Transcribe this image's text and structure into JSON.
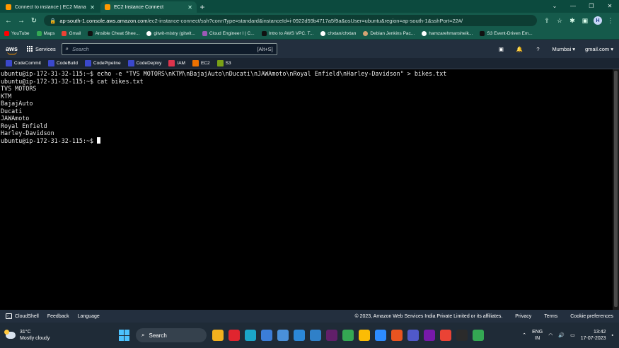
{
  "browser": {
    "tabs": [
      {
        "title": "Connect to instance | EC2 Manag",
        "active": false,
        "color": "#ff9900"
      },
      {
        "title": "EC2 Instance Connect",
        "active": true,
        "color": "#ff9900"
      }
    ],
    "url_host": "ap-south-1.console.aws.amazon.com",
    "url_path": "/ec2-instance-connect/ssh?connType=standard&instanceId=i-0922d59b4717a5f9a&osUser=ubuntu&region=ap-south-1&sshPort=22#/",
    "profile_initial": "H",
    "bookmarks": [
      {
        "label": "YouTube",
        "color": "#ff0000"
      },
      {
        "label": "Maps",
        "color": "#34a853"
      },
      {
        "label": "Gmail",
        "color": "#ea4335"
      },
      {
        "label": "Ansible Cheat Shee...",
        "color": "#111111"
      },
      {
        "label": "gitwit-mistry (gitwit...",
        "color": "#ffffff"
      },
      {
        "label": "Cloud Engineer I | C...",
        "color": "#9b59b6"
      },
      {
        "label": "Intro to AWS VPC. T...",
        "color": "#111111"
      },
      {
        "label": "chxtan/chxtan",
        "color": "#ffffff"
      },
      {
        "label": "Debian Jenkins Pac...",
        "color": "#d4a373"
      },
      {
        "label": "hamzarehmansheik...",
        "color": "#ffffff"
      },
      {
        "label": "S3 Event-Driven Em...",
        "color": "#111111"
      }
    ]
  },
  "aws": {
    "logo": "aws",
    "services_label": "Services",
    "search_placeholder": "Search",
    "search_shortcut": "[Alt+S]",
    "region": "Mumbai ▾",
    "account": "gmail.com ▾",
    "favorites": [
      {
        "label": "CodeCommit",
        "color": "#3b48cc"
      },
      {
        "label": "CodeBuild",
        "color": "#3b48cc"
      },
      {
        "label": "CodePipeline",
        "color": "#3b48cc"
      },
      {
        "label": "CodeDeploy",
        "color": "#3b48cc"
      },
      {
        "label": "IAM",
        "color": "#dd344c"
      },
      {
        "label": "EC2",
        "color": "#ed7100"
      },
      {
        "label": "S3",
        "color": "#7aa116"
      }
    ]
  },
  "terminal": {
    "lines": [
      "ubuntu@ip-172-31-32-115:~$ echo -e \"TVS MOTORS\\nKTM\\nBajajAuto\\nDucati\\nJAWAmoto\\nRoyal Enfield\\nHarley-Davidson\" > bikes.txt",
      "ubuntu@ip-172-31-32-115:~$ cat bikes.txt",
      "TVS MOTORS",
      "KTM",
      "BajajAuto",
      "Ducati",
      "JAWAmoto",
      "Royal Enfield",
      "Harley-Davidson"
    ],
    "prompt": "ubuntu@ip-172-31-32-115:~$ "
  },
  "footer": {
    "cloudshell": "CloudShell",
    "feedback": "Feedback",
    "language": "Language",
    "copyright": "© 2023, Amazon Web Services India Private Limited or its affiliates.",
    "privacy": "Privacy",
    "terms": "Terms",
    "cookie": "Cookie preferences"
  },
  "taskbar": {
    "temperature": "31°C",
    "weather": "Mostly cloudy",
    "search_label": "Search",
    "lang_top": "ENG",
    "lang_bottom": "IN",
    "time": "13:42",
    "date": "17-07-2023",
    "apps": [
      {
        "name": "file-explorer-icon",
        "color": "#f2b01e"
      },
      {
        "name": "opera-icon",
        "color": "#e0252f"
      },
      {
        "name": "edge-icon",
        "color": "#1ba6c9"
      },
      {
        "name": "store-icon",
        "color": "#3b7dd8"
      },
      {
        "name": "app-icon",
        "color": "#4a90d9"
      },
      {
        "name": "photos-icon",
        "color": "#2b88d8"
      },
      {
        "name": "vscode-icon",
        "color": "#2f80c8"
      },
      {
        "name": "slack-icon",
        "color": "#611f69"
      },
      {
        "name": "chrome-icon",
        "color": "#34a853"
      },
      {
        "name": "chrome-2-icon",
        "color": "#fbbc05"
      },
      {
        "name": "zoom-icon",
        "color": "#2d8cff"
      },
      {
        "name": "wsl-icon",
        "color": "#e95420"
      },
      {
        "name": "teams-icon",
        "color": "#5059c9"
      },
      {
        "name": "onenote-icon",
        "color": "#7719aa"
      },
      {
        "name": "chrome-3-icon",
        "color": "#ea4335"
      },
      {
        "name": "terminal-icon",
        "color": "#2b2b2b"
      },
      {
        "name": "chrome-active-icon",
        "color": "#34a853"
      }
    ]
  }
}
